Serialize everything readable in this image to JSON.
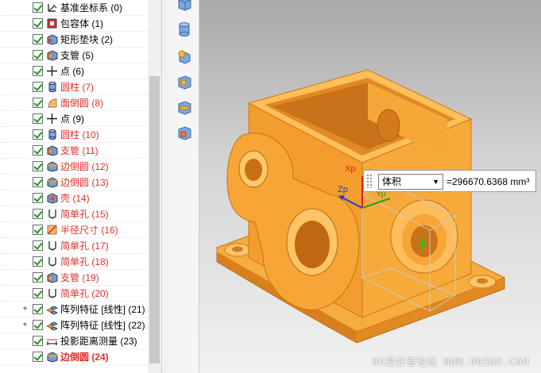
{
  "tree": {
    "items": [
      {
        "label": "基准坐标系 (0)",
        "icon": "datum-csys-icon",
        "red": false,
        "bold": false,
        "expander": ""
      },
      {
        "label": "包容体 (1)",
        "icon": "bounding-body-icon",
        "red": false,
        "bold": false,
        "expander": ""
      },
      {
        "label": "矩形垫块 (2)",
        "icon": "rect-pad-icon",
        "red": false,
        "bold": false,
        "expander": ""
      },
      {
        "label": "支管 (5)",
        "icon": "boss-icon",
        "red": false,
        "bold": false,
        "expander": ""
      },
      {
        "label": "点 (6)",
        "icon": "point-icon",
        "red": false,
        "bold": false,
        "expander": ""
      },
      {
        "label": "圆柱 (7)",
        "icon": "cylinder-icon",
        "red": true,
        "bold": false,
        "expander": ""
      },
      {
        "label": "面倒圆 (8)",
        "icon": "face-blend-icon",
        "red": true,
        "bold": false,
        "expander": ""
      },
      {
        "label": "点 (9)",
        "icon": "point-icon",
        "red": false,
        "bold": false,
        "expander": ""
      },
      {
        "label": "圆柱 (10)",
        "icon": "cylinder-icon",
        "red": true,
        "bold": false,
        "expander": ""
      },
      {
        "label": "支管 (11)",
        "icon": "boss-icon",
        "red": true,
        "bold": false,
        "expander": ""
      },
      {
        "label": "边倒圆 (12)",
        "icon": "edge-blend-icon",
        "red": true,
        "bold": false,
        "expander": ""
      },
      {
        "label": "边倒圆 (13)",
        "icon": "edge-blend-icon",
        "red": true,
        "bold": false,
        "expander": ""
      },
      {
        "label": "壳 (14)",
        "icon": "shell-icon",
        "red": true,
        "bold": false,
        "expander": ""
      },
      {
        "label": "简单孔 (15)",
        "icon": "hole-icon",
        "red": true,
        "bold": false,
        "expander": ""
      },
      {
        "label": "半径尺寸 (16)",
        "icon": "radius-dim-icon",
        "red": true,
        "bold": false,
        "expander": ""
      },
      {
        "label": "简单孔 (17)",
        "icon": "hole-icon",
        "red": true,
        "bold": false,
        "expander": ""
      },
      {
        "label": "简单孔 (18)",
        "icon": "hole-icon",
        "red": true,
        "bold": false,
        "expander": ""
      },
      {
        "label": "支管 (19)",
        "icon": "boss-icon",
        "red": true,
        "bold": false,
        "expander": ""
      },
      {
        "label": "简单孔 (20)",
        "icon": "hole-icon",
        "red": true,
        "bold": false,
        "expander": ""
      },
      {
        "label": "阵列特征 [线性] (21)",
        "icon": "pattern-icon",
        "red": false,
        "bold": false,
        "expander": "+"
      },
      {
        "label": "阵列特征 [线性] (22)",
        "icon": "pattern-icon",
        "red": false,
        "bold": false,
        "expander": "+"
      },
      {
        "label": "投影距离测量 (23)",
        "icon": "measure-icon",
        "red": false,
        "bold": false,
        "expander": ""
      },
      {
        "label": "边倒圆 (24)",
        "icon": "edge-blend-icon",
        "red": true,
        "bold": true,
        "expander": ""
      }
    ]
  },
  "toolbar": {
    "tools": [
      "block-icon",
      "cylinder-tool-icon",
      "sphere-block-icon",
      "boss-tool-icon",
      "pad-tool-icon",
      "pocket-tool-icon"
    ]
  },
  "viewport": {
    "axes": {
      "x": "Xp",
      "z": "Zp",
      "y": "Yp"
    },
    "measure": {
      "type": "体积",
      "value": "=296670.6368 mm³"
    },
    "watermark": "UG爱好者论坛 WWW.UGSNX.COM"
  },
  "colors": {
    "part": "#f5a623",
    "part_dark": "#d9821a",
    "part_light": "#ffc96b",
    "red_label": "#e0302a",
    "check": "#13a10e"
  }
}
